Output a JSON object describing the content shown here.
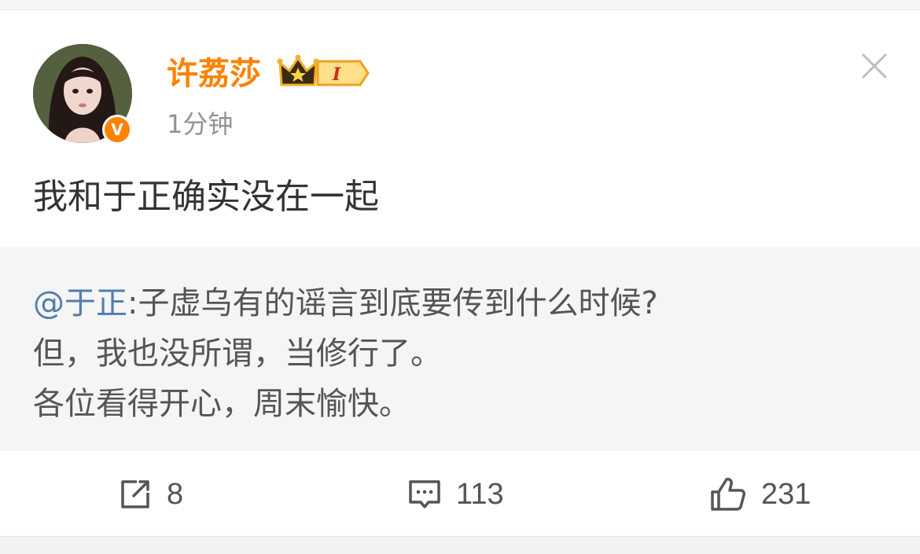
{
  "post": {
    "username": "许荔莎",
    "level_badge": "I",
    "verified_mark": "V",
    "time": "1分钟",
    "text": "我和于正确实没在一起"
  },
  "repost": {
    "mention": "@于正",
    "line1_rest": ":子虚乌有的谣言到底要传到什么时候?",
    "line2": "但，我也没所谓，当修行了。",
    "line3": "各位看得开心，周末愉快。"
  },
  "actions": {
    "share_count": "8",
    "comment_count": "113",
    "like_count": "231"
  },
  "icons": {
    "close": "close-icon",
    "share": "share-icon",
    "comment": "comment-icon",
    "like": "thumbs-up-icon",
    "crown": "crown-icon"
  },
  "colors": {
    "username": "#ff8200",
    "mention": "#507daf",
    "repost_bg": "#f5f5f5"
  }
}
